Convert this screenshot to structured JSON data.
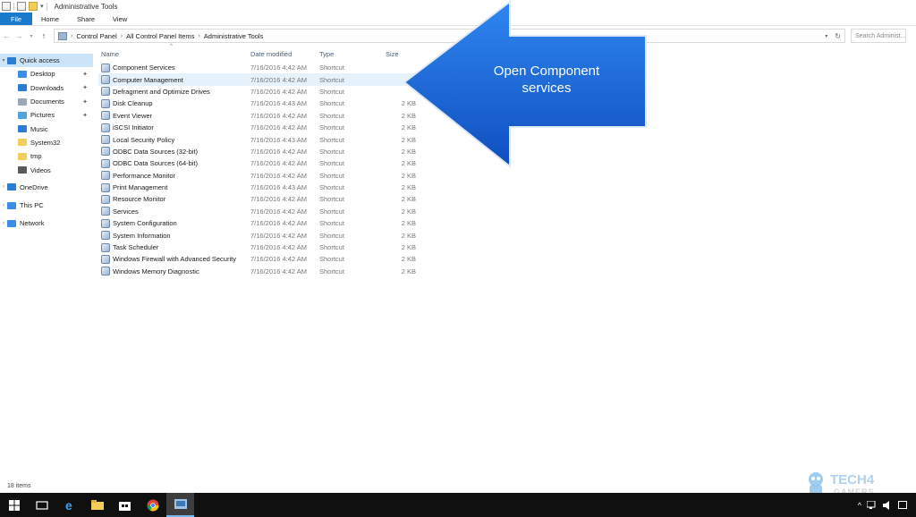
{
  "window": {
    "title": "Administrative Tools"
  },
  "ribbon": {
    "tabs": [
      "File",
      "Home",
      "Share",
      "View"
    ]
  },
  "address": {
    "crumbs": [
      "Control Panel",
      "All Control Panel Items",
      "Administrative Tools"
    ],
    "search_placeholder": "Search Administ..."
  },
  "nav": {
    "items": [
      {
        "label": "Quick access",
        "icon": "star-icon",
        "color": "#2b7cd3",
        "selected": true,
        "expander": true
      },
      {
        "label": "Desktop",
        "icon": "desktop-icon",
        "color": "#3a8ee6",
        "pinned": true
      },
      {
        "label": "Downloads",
        "icon": "download-icon",
        "color": "#2b7cd3",
        "pinned": true
      },
      {
        "label": "Documents",
        "icon": "documents-icon",
        "color": "#9aa7b6",
        "pinned": true
      },
      {
        "label": "Pictures",
        "icon": "pictures-icon",
        "color": "#4fa3e0",
        "pinned": true
      },
      {
        "label": "Music",
        "icon": "music-icon",
        "color": "#2b7cd3"
      },
      {
        "label": "System32",
        "icon": "folder-icon",
        "color": "#f3cd5a"
      },
      {
        "label": "tmp",
        "icon": "folder-icon",
        "color": "#f3cd5a"
      },
      {
        "label": "Videos",
        "icon": "videos-icon",
        "color": "#5a5a5a"
      },
      {
        "label": "OneDrive",
        "icon": "onedrive-icon",
        "color": "#2b7cd3",
        "expander": true
      },
      {
        "label": "This PC",
        "icon": "pc-icon",
        "color": "#3a8ee6",
        "expander": true
      },
      {
        "label": "Network",
        "icon": "network-icon",
        "color": "#3a8ee6",
        "expander": true
      }
    ]
  },
  "columns": {
    "name": "Name",
    "date": "Date modified",
    "type": "Type",
    "size": "Size"
  },
  "files": [
    {
      "name": "Component Services",
      "date": "7/16/2016 4:42 AM",
      "type": "Shortcut",
      "size": ""
    },
    {
      "name": "Computer Management",
      "date": "7/16/2016 4:42 AM",
      "type": "Shortcut",
      "size": ""
    },
    {
      "name": "Defragment and Optimize Drives",
      "date": "7/16/2016 4:42 AM",
      "type": "Shortcut",
      "size": ""
    },
    {
      "name": "Disk Cleanup",
      "date": "7/16/2016 4:43 AM",
      "type": "Shortcut",
      "size": "2 KB"
    },
    {
      "name": "Event Viewer",
      "date": "7/16/2016 4:42 AM",
      "type": "Shortcut",
      "size": "2 KB"
    },
    {
      "name": "iSCSI Initiator",
      "date": "7/16/2016 4:42 AM",
      "type": "Shortcut",
      "size": "2 KB"
    },
    {
      "name": "Local Security Policy",
      "date": "7/16/2016 4:43 AM",
      "type": "Shortcut",
      "size": "2 KB"
    },
    {
      "name": "ODBC Data Sources (32-bit)",
      "date": "7/16/2016 4:42 AM",
      "type": "Shortcut",
      "size": "2 KB"
    },
    {
      "name": "ODBC Data Sources (64-bit)",
      "date": "7/16/2016 4:42 AM",
      "type": "Shortcut",
      "size": "2 KB"
    },
    {
      "name": "Performance Monitor",
      "date": "7/16/2016 4:42 AM",
      "type": "Shortcut",
      "size": "2 KB"
    },
    {
      "name": "Print Management",
      "date": "7/16/2016 4:43 AM",
      "type": "Shortcut",
      "size": "2 KB"
    },
    {
      "name": "Resource Monitor",
      "date": "7/16/2016 4:42 AM",
      "type": "Shortcut",
      "size": "2 KB"
    },
    {
      "name": "Services",
      "date": "7/16/2016 4:42 AM",
      "type": "Shortcut",
      "size": "2 KB"
    },
    {
      "name": "System Configuration",
      "date": "7/16/2016 4:42 AM",
      "type": "Shortcut",
      "size": "2 KB"
    },
    {
      "name": "System Information",
      "date": "7/16/2016 4:42 AM",
      "type": "Shortcut",
      "size": "2 KB"
    },
    {
      "name": "Task Scheduler",
      "date": "7/16/2016 4:42 AM",
      "type": "Shortcut",
      "size": "2 KB"
    },
    {
      "name": "Windows Firewall with Advanced Security",
      "date": "7/16/2016 4:42 AM",
      "type": "Shortcut",
      "size": "2 KB"
    },
    {
      "name": "Windows Memory Diagnostic",
      "date": "7/16/2016 4:42 AM",
      "type": "Shortcut",
      "size": "2 KB"
    }
  ],
  "callout": {
    "text": "Open Component services",
    "color": "#1565d8"
  },
  "status": {
    "count": "18 items"
  },
  "watermark": {
    "line1": "TECH4",
    "line2": "GAMERS"
  },
  "taskbar": {
    "items": [
      "windows-start-icon",
      "task-view-icon",
      "edge-icon",
      "file-explorer-icon",
      "store-icon",
      "chrome-icon",
      "admin-tools-icon"
    ]
  }
}
